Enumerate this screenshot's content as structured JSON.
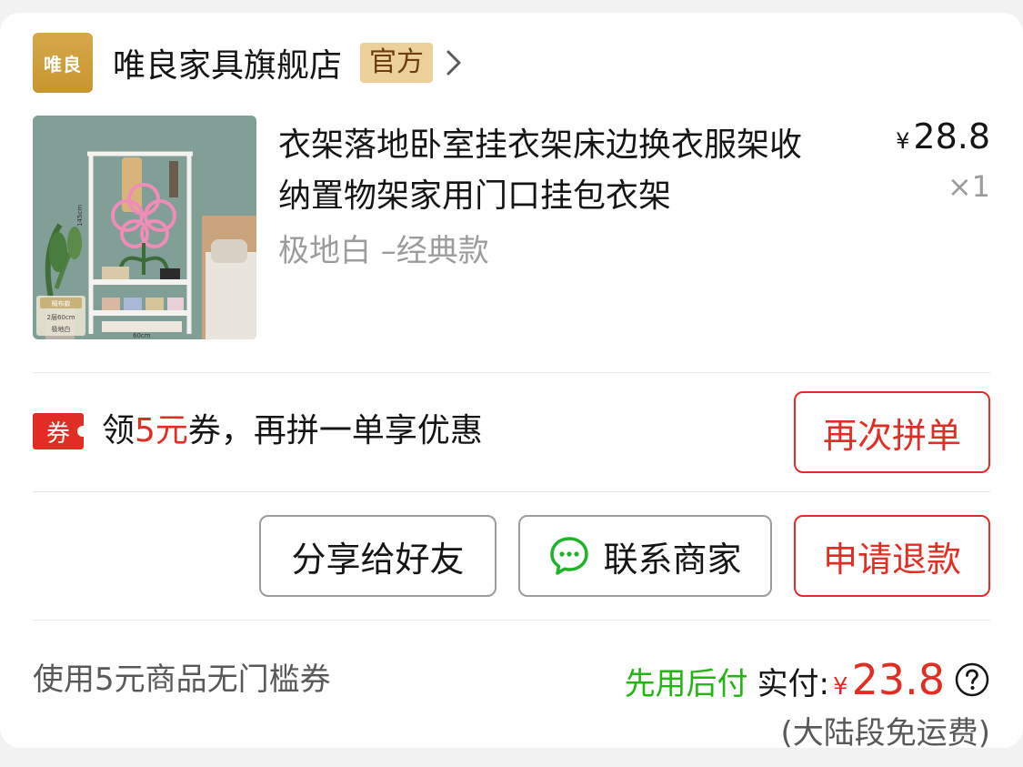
{
  "shop": {
    "logo_text": "唯良",
    "name": "唯良家具旗舰店",
    "badge": "官方"
  },
  "product": {
    "title": "衣架落地卧室挂衣架床边换衣服架收纳置物架家用门口挂包衣架",
    "spec": "极地白 –经典款",
    "price_symbol": "¥",
    "price": "28.8",
    "quantity": "×1",
    "image": {
      "size_label": "145cm",
      "width_label": "60cm",
      "tag_line1": "隔布款",
      "tag_line2": "2层60cm",
      "tag_line3": "极地白"
    }
  },
  "coupon": {
    "tag": "券",
    "text_prefix": "领",
    "text_highlight": "5元",
    "text_suffix": "券，再拼一单享优惠",
    "button": "再次拼单"
  },
  "actions": {
    "share": "分享给好友",
    "contact": "联系商家",
    "refund": "申请退款"
  },
  "footer": {
    "coupon_note": "使用5元商品无门槛券",
    "pay_later": "先用后付",
    "paid_label": "实付:",
    "paid_symbol": "¥",
    "paid_amount": "23.8",
    "shipping": "(大陆段免运费)"
  },
  "colors": {
    "accent_red": "#e02e24",
    "pay_later_green": "#25b513",
    "badge_gold": "#ecd09a",
    "logo_gold": "#c8962f"
  }
}
